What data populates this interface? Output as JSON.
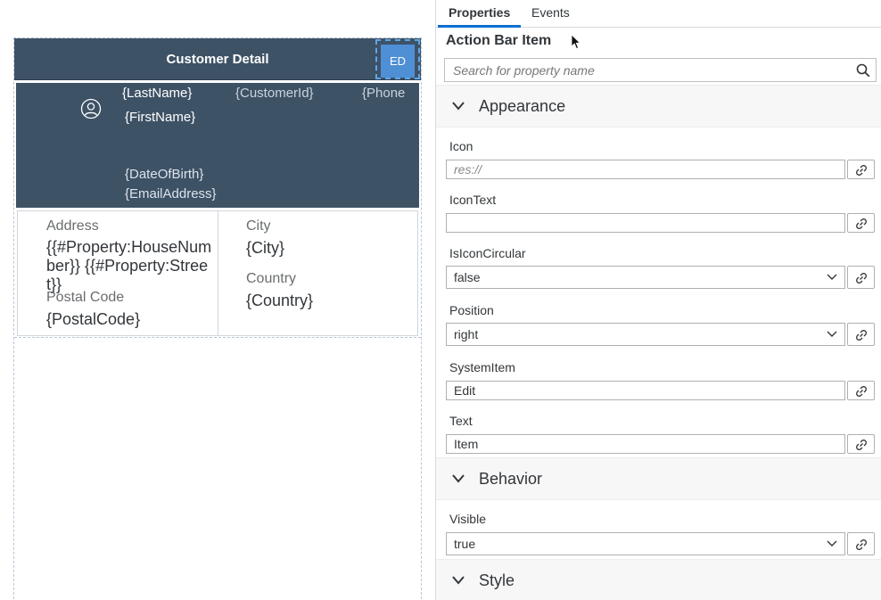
{
  "canvas": {
    "action_bar": {
      "title": "Customer Detail",
      "item_label": "ED"
    },
    "header": {
      "last_name": "{LastName}",
      "first_name": "{FirstName}",
      "customer_id": "{CustomerId}",
      "phone": "{Phone",
      "date_of_birth": "{DateOfBirth}",
      "email": "{EmailAddress}"
    },
    "key_values": {
      "address_label": "Address",
      "address_value": "{{#Property:HouseNumber}} {{#Property:Street}}",
      "postal_code_label": "Postal Code",
      "postal_code_value": "{PostalCode}",
      "city_label": "City",
      "city_value": "{City}",
      "country_label": "Country",
      "country_value": "{Country}"
    }
  },
  "panel": {
    "tabs": [
      "Properties",
      "Events"
    ],
    "active_tab": "Properties",
    "title": "Action Bar Item",
    "search": {
      "placeholder": "Search for property name",
      "value": ""
    },
    "sections": {
      "appearance": "Appearance",
      "behavior": "Behavior",
      "style": "Style"
    },
    "properties": {
      "icon": {
        "label": "Icon",
        "placeholder": "res://",
        "value": ""
      },
      "icon_text": {
        "label": "IconText",
        "value": ""
      },
      "is_icon_circular": {
        "label": "IsIconCircular",
        "value": "false"
      },
      "position": {
        "label": "Position",
        "value": "right"
      },
      "system_item": {
        "label": "SystemItem",
        "value": "Edit"
      },
      "text": {
        "label": "Text",
        "value": "Item"
      },
      "visible": {
        "label": "Visible",
        "value": "true"
      }
    }
  },
  "colors": {
    "header_bg": "#3e5266",
    "action_item_bg": "#4f8fd6",
    "active_tab_underline": "#0a6ed1",
    "section_bg": "#f7f7f7"
  }
}
